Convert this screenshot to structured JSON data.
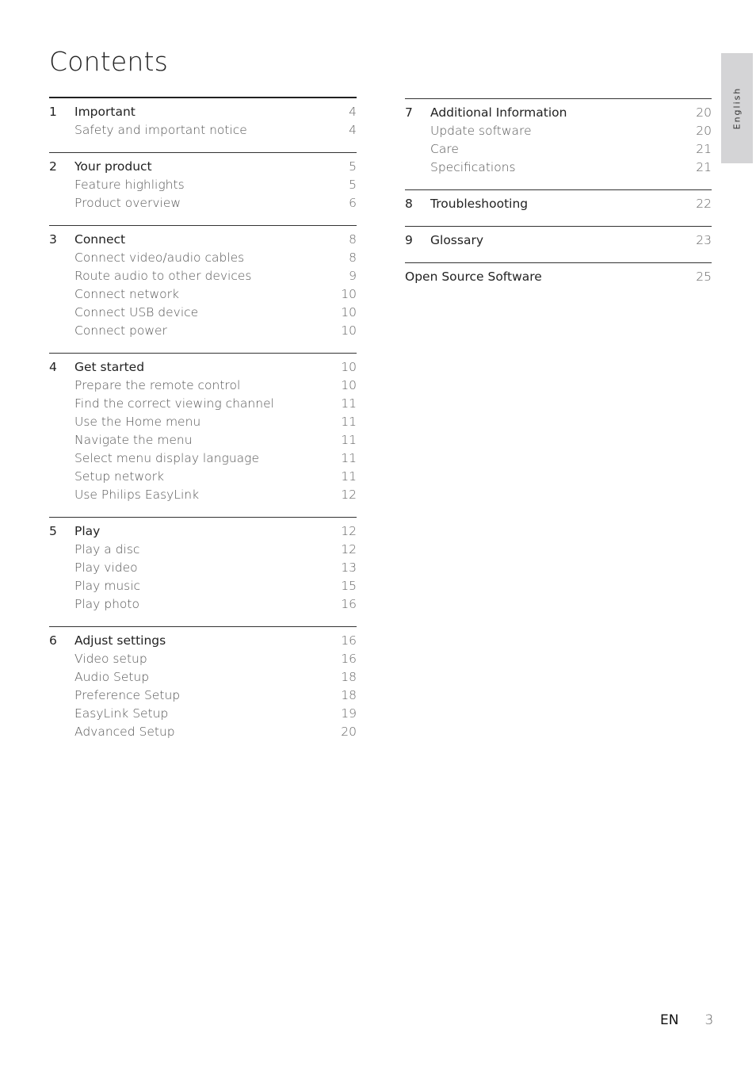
{
  "page_title": "Contents",
  "language_tab": "English",
  "footer": {
    "lang": "EN",
    "page": "3"
  },
  "left_sections": [
    {
      "num": "1",
      "title": "Important",
      "page": "4",
      "items": [
        {
          "label": "Safety and important notice",
          "page": "4"
        }
      ]
    },
    {
      "num": "2",
      "title": "Your product",
      "page": "5",
      "items": [
        {
          "label": "Feature highlights",
          "page": "5"
        },
        {
          "label": "Product overview",
          "page": "6"
        }
      ]
    },
    {
      "num": "3",
      "title": "Connect",
      "page": "8",
      "items": [
        {
          "label": "Connect video/audio cables",
          "page": "8"
        },
        {
          "label": "Route audio to other devices",
          "page": "9"
        },
        {
          "label": "Connect network",
          "page": "10"
        },
        {
          "label": "Connect USB device",
          "page": "10"
        },
        {
          "label": "Connect power",
          "page": "10"
        }
      ]
    },
    {
      "num": "4",
      "title": "Get started",
      "page": "10",
      "items": [
        {
          "label": "Prepare the remote control",
          "page": "10"
        },
        {
          "label": "Find the correct viewing channel",
          "page": "11"
        },
        {
          "label": "Use the Home menu",
          "page": "11"
        },
        {
          "label": "Navigate the menu",
          "page": "11"
        },
        {
          "label": "Select menu display language",
          "page": "11"
        },
        {
          "label": "Setup network",
          "page": "11"
        },
        {
          "label": "Use Philips EasyLink",
          "page": "12"
        }
      ]
    },
    {
      "num": "5",
      "title": "Play",
      "page": "12",
      "items": [
        {
          "label": "Play a disc",
          "page": "12"
        },
        {
          "label": "Play video",
          "page": "13"
        },
        {
          "label": "Play music",
          "page": "15"
        },
        {
          "label": "Play photo",
          "page": "16"
        }
      ]
    },
    {
      "num": "6",
      "title": "Adjust settings",
      "page": "16",
      "items": [
        {
          "label": "Video setup",
          "page": "16"
        },
        {
          "label": "Audio Setup",
          "page": "18"
        },
        {
          "label": "Preference Setup",
          "page": "18"
        },
        {
          "label": "EasyLink Setup",
          "page": "19"
        },
        {
          "label": "Advanced Setup",
          "page": "20"
        }
      ]
    }
  ],
  "right_sections": [
    {
      "num": "7",
      "title": "Additional Information",
      "page": "20",
      "items": [
        {
          "label": "Update software",
          "page": "20"
        },
        {
          "label": "Care",
          "page": "21"
        },
        {
          "label": "Specifications",
          "page": "21"
        }
      ]
    },
    {
      "num": "8",
      "title": "Troubleshooting",
      "page": "22",
      "items": []
    },
    {
      "num": "9",
      "title": "Glossary",
      "page": "23",
      "items": []
    },
    {
      "num": "",
      "title": "Open Source Software",
      "page": "25",
      "items": []
    }
  ]
}
